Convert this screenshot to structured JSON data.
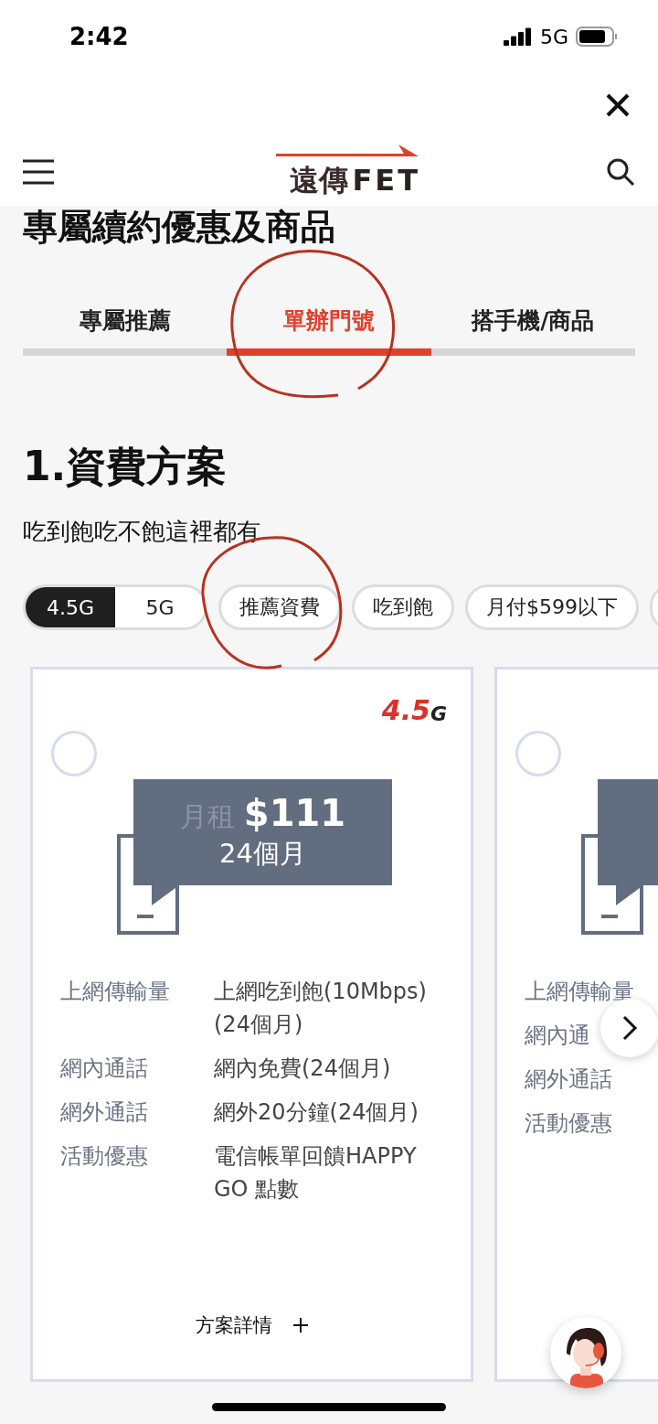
{
  "status_bar": {
    "time": "2:42",
    "network": "5G"
  },
  "header": {
    "logo": {
      "chinese": "遠傳",
      "latin": "FET"
    }
  },
  "page_title": "專屬續約優惠及商品",
  "tabs": [
    {
      "label": "專屬推薦",
      "selected": false
    },
    {
      "label": "單辦門號",
      "selected": true
    },
    {
      "label": "搭手機/商品",
      "selected": false
    }
  ],
  "section": {
    "title": "1.資費方案",
    "subtitle": "吃到飽吃不飽這裡都有"
  },
  "network_toggle": [
    {
      "label": "4.5G",
      "selected": true
    },
    {
      "label": "5G",
      "selected": false
    }
  ],
  "filter_chips": [
    {
      "label": "推薦資費"
    },
    {
      "label": "吃到飽"
    },
    {
      "label": "月付$599以下"
    }
  ],
  "more_chips_cut_off": true,
  "plans": [
    {
      "selected": false,
      "badge": {
        "number": "4.5",
        "letter": "G"
      },
      "price_label": "月租",
      "price": "$111",
      "term": "24個月",
      "features": [
        {
          "label": "上網傳輸量",
          "value": "上網吃到飽(10Mbps)(24個月)"
        },
        {
          "label": "網內通話",
          "value": "網內免費(24個月)"
        },
        {
          "label": "網外通話",
          "value": "網外20分鐘(24個月)"
        },
        {
          "label": "活動優惠",
          "value": "電信帳單回饋HAPPY GO 點數"
        }
      ],
      "details": "方案詳情"
    },
    {
      "selected": false,
      "features": [
        {
          "label": "上網傳輸量"
        },
        {
          "label": "網內通"
        },
        {
          "label": "網外通話"
        },
        {
          "label": "活動優惠"
        }
      ]
    }
  ],
  "annotations": [
    {
      "kind": "circle"
    },
    {
      "kind": "circle"
    }
  ]
}
